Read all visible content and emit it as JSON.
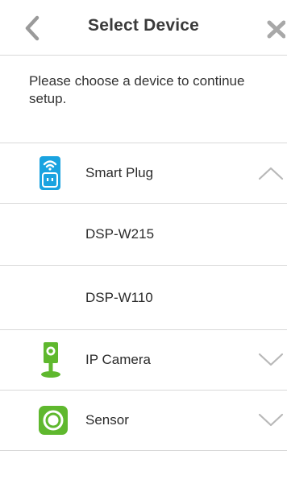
{
  "header": {
    "title": "Select Device",
    "back_icon": "chevron-left-icon",
    "close_icon": "close-icon"
  },
  "intro": {
    "text": "Please choose a device to continue setup."
  },
  "devices": [
    {
      "label": "Smart Plug",
      "icon": "smart-plug-icon",
      "expanded": true,
      "models": [
        "DSP-W215",
        "DSP-W110"
      ]
    },
    {
      "label": "IP Camera",
      "icon": "ip-camera-icon",
      "expanded": false
    },
    {
      "label": "Sensor",
      "icon": "sensor-icon",
      "expanded": false
    }
  ],
  "colors": {
    "plug_blue": "#1aa3e0",
    "camera_green": "#5fb82e",
    "sensor_green": "#5fb82e",
    "chevron_gray": "#b8b8b8",
    "divider": "#d9d9d9"
  }
}
